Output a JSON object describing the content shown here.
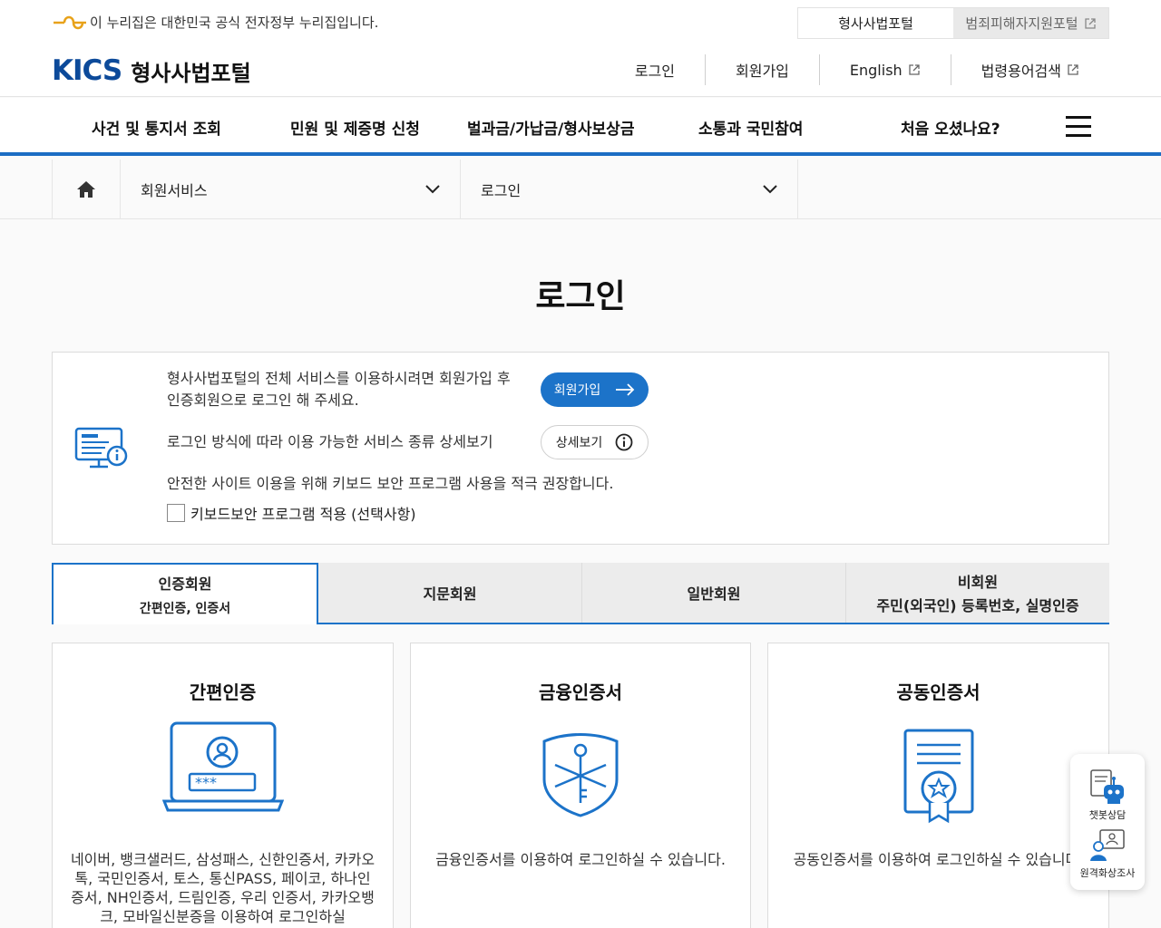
{
  "gov_banner": {
    "text": "이 누리집은 대한민국 공식 전자정부 누리집입니다."
  },
  "portal_tabs": [
    {
      "label": "형사사법포털"
    },
    {
      "label": "범죄피해자지원포털"
    }
  ],
  "brand": {
    "mark": "KICS",
    "name": "형사사법포털"
  },
  "utility_nav": [
    {
      "label": "로그인"
    },
    {
      "label": "회원가입"
    },
    {
      "label": "English"
    },
    {
      "label": "법령용어검색"
    }
  ],
  "gnb": [
    {
      "label": "사건 및 통지서 조회"
    },
    {
      "label": "민원 및 제증명 신청"
    },
    {
      "label": "벌과금/가납금/형사보상금"
    },
    {
      "label": "소통과 국민참여"
    },
    {
      "label": "처음 오셨나요?"
    }
  ],
  "breadcrumb": {
    "level1": "회원서비스",
    "level2": "로그인"
  },
  "page_title": "로그인",
  "info": {
    "line1a": "형사사법포털의 전체 서비스를 이용하시려면 회원가입 후",
    "line1b": "인증회원으로 로그인 해 주세요.",
    "line2": "로그인 방식에 따라 이용 가능한 서비스 종류 상세보기",
    "line3": "안전한 사이트 이용을 위해 키보드 보안 프로그램 사용을 적극 권장합니다.",
    "join_button": "회원가입",
    "detail_button": "상세보기",
    "checkbox_label": "키보드보안 프로그램 적용 (선택사항)"
  },
  "tabs": [
    {
      "label": "인증회원",
      "sub": "간편인증, 인증서"
    },
    {
      "label": "지문회원"
    },
    {
      "label": "일반회원"
    },
    {
      "label": "비회원",
      "sub": "주민(외국인) 등록번호, 실명인증"
    }
  ],
  "cards": [
    {
      "title": "간편인증",
      "desc": "네이버, 뱅크샐러드, 삼성패스, 신한인증서, 카카오톡, 국민인증서, 토스, 통신PASS, 페이코, 하나인증서, NH인증서, 드림인증, 우리 인증서, 카카오뱅크, 모바일신분증을 이용하여 로그인하실"
    },
    {
      "title": "금융인증서",
      "desc": "금융인증서를 이용하여 로그인하실 수 있습니다."
    },
    {
      "title": "공동인증서",
      "desc": "공동인증서를 이용하여 로그인하실 수 있습니다."
    }
  ],
  "floating": [
    {
      "label": "챗봇상담"
    },
    {
      "label": "원격화상조사"
    }
  ],
  "colors": {
    "primary": "#1c73c9",
    "brand": "#0c4a9a",
    "gov_logo": "#e8a21a"
  }
}
